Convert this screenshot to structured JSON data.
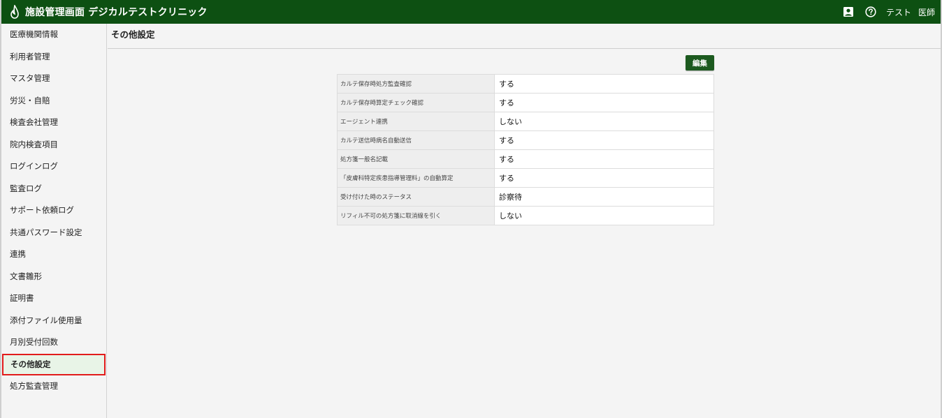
{
  "header": {
    "title": "施設管理画面 デジカルテストクリニック",
    "user_name": "テスト",
    "user_role": "医師",
    "icons": [
      "profile-icon",
      "help-icon"
    ]
  },
  "sidebar": {
    "items": [
      {
        "label": "医療機関情報"
      },
      {
        "label": "利用者管理"
      },
      {
        "label": "マスタ管理"
      },
      {
        "label": "労災・自賠"
      },
      {
        "label": "検査会社管理"
      },
      {
        "label": "院内検査項目"
      },
      {
        "label": "ログインログ"
      },
      {
        "label": "監査ログ"
      },
      {
        "label": "サポート依頼ログ"
      },
      {
        "label": "共通パスワード設定"
      },
      {
        "label": "連携"
      },
      {
        "label": "文書雛形"
      },
      {
        "label": "証明書"
      },
      {
        "label": "添付ファイル使用量"
      },
      {
        "label": "月別受付回数"
      },
      {
        "label": "その他設定"
      },
      {
        "label": "処方監査管理"
      }
    ],
    "active_index": 15
  },
  "main": {
    "title": "その他設定",
    "edit_label": "編集",
    "settings": [
      {
        "label": "カルテ保存時処方監査確認",
        "value": "する"
      },
      {
        "label": "カルテ保存時算定チェック確認",
        "value": "する"
      },
      {
        "label": "エージェント連携",
        "value": "しない"
      },
      {
        "label": "カルテ送信時病名自動送信",
        "value": "する"
      },
      {
        "label": "処方箋一般名記載",
        "value": "する"
      },
      {
        "label": "「皮膚科特定疾患指導管理料」の自動算定",
        "value": "する"
      },
      {
        "label": "受け付けた時のステータス",
        "value": "診察待"
      },
      {
        "label": "リフィル不可の処方箋に取消線を引く",
        "value": "しない"
      }
    ]
  },
  "colors": {
    "header_bg": "#0d5012",
    "button_bg": "#1c5a1f",
    "active_bg": "#e8f4e7",
    "active_border": "#e21b1b"
  }
}
